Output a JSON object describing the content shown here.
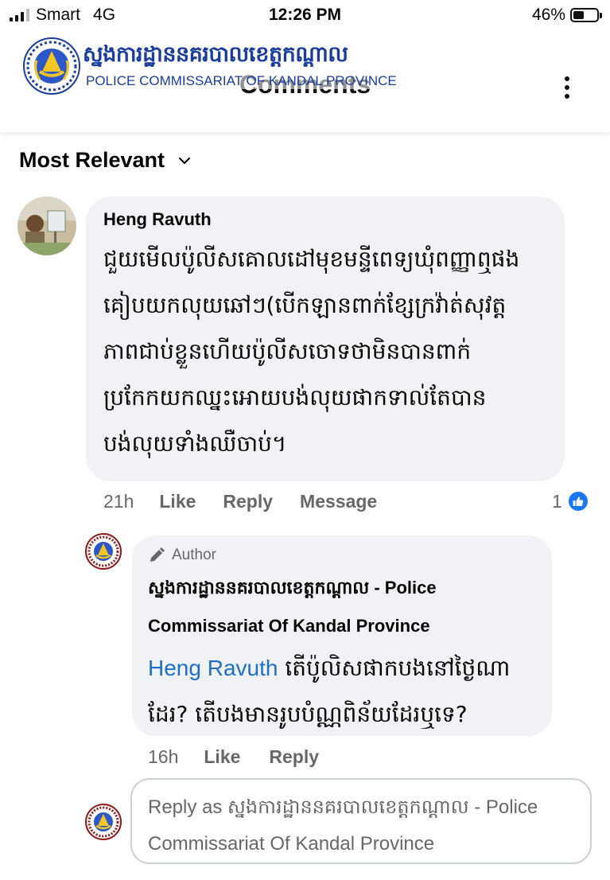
{
  "status_bar": {
    "carrier": "Smart",
    "network": "4G",
    "time": "12:26 PM",
    "battery_percent": "46%",
    "battery_level": 0.46
  },
  "header": {
    "title": "Comments",
    "watermark_khmer": "ស្នងការដ្ឋាននគរបាលខេត្តកណ្តាល",
    "watermark_english": "POLICE COMMISSARIAT OF KANDAL PROVINCE"
  },
  "sort": {
    "label": "Most Relevant"
  },
  "comment": {
    "author": "Heng Ravuth",
    "lines": [
      "ជួយមើលប៉ូលីសគោលដៅមុខមន្ទីពេទ្យឃុំពញ្ញាឮផង",
      "គៀបយកលុយឆៅៗ(បើកឡានពាក់ខ្សែក្រវ៉ាត់សុវត្ត",
      "ភាពជាប់ខ្លួនហើយប៉ូលីសចោទថាមិនបានពាក់",
      "ប្រកែកយកឈ្នះអោយបង់លុយផាកទាល់តែបាន",
      "បង់លុយទាំងឈឺចាប់។"
    ],
    "time": "21h",
    "like_label": "Like",
    "reply_label": "Reply",
    "message_label": "Message",
    "reaction_count": "1"
  },
  "reply": {
    "badge": "Author",
    "author_line1": "ស្នងការដ្ឋាននគរបាលខេត្តកណ្តាល - Police",
    "author_line2": "Commissariat Of Kandal Province",
    "mention": "Heng Ravuth",
    "text_line1": " តើប៉ូលិសផាកបងនៅថ្ងៃណា",
    "text_line2": "ដែរ? តើបងមានរូបបំណ្ណពិន័យដែរឬទេ?",
    "time": "16h",
    "like_label": "Like",
    "reply_label": "Reply"
  },
  "reply_box": {
    "line1": "Reply as ស្នងការដ្ឋាននគរបាលខេត្តកណ្តាល - Police",
    "line2": "Commissariat Of Kandal Province"
  },
  "colors": {
    "accent": "#1877f2",
    "bubble": "#f0f2f5",
    "meta_text": "#65676b",
    "mention": "#1d6fc9",
    "watermark": "#1a3c9c"
  }
}
